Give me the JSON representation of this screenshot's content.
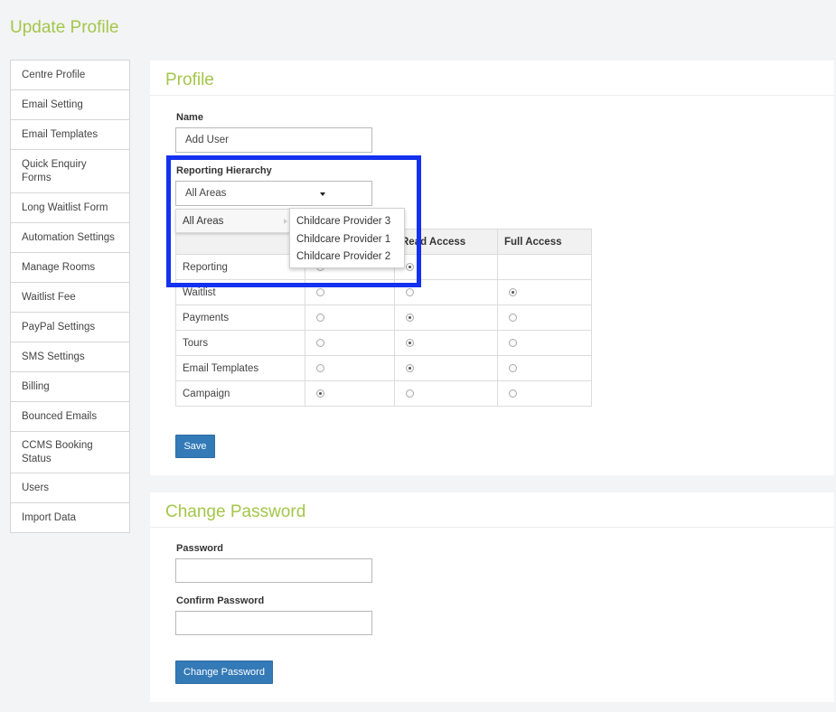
{
  "page": {
    "title": "Update Profile"
  },
  "sidebar": {
    "items": [
      {
        "label": "Centre Profile"
      },
      {
        "label": "Email Setting"
      },
      {
        "label": "Email Templates"
      },
      {
        "label": "Quick Enquiry Forms"
      },
      {
        "label": "Long Waitlist Form"
      },
      {
        "label": "Automation Settings"
      },
      {
        "label": "Manage Rooms"
      },
      {
        "label": "Waitlist Fee"
      },
      {
        "label": "PayPal Settings"
      },
      {
        "label": "SMS Settings"
      },
      {
        "label": "Billing"
      },
      {
        "label": "Bounced Emails"
      },
      {
        "label": "CCMS Booking Status"
      },
      {
        "label": "Users"
      },
      {
        "label": "Import Data"
      }
    ]
  },
  "profile": {
    "heading": "Profile",
    "name_label": "Name",
    "name_value": "Add User",
    "hierarchy_label": "Reporting Hierarchy",
    "hierarchy_value": "All Areas",
    "menu": {
      "item": "All Areas",
      "submenu": [
        "Childcare Provider 3",
        "Childcare Provider 1",
        "Childcare Provider 2"
      ]
    },
    "table": {
      "headers": [
        "",
        "",
        "Read Access",
        "Full Access"
      ],
      "rows": [
        {
          "label": "Reporting",
          "selected": 1,
          "options": 2
        },
        {
          "label": "Waitlist",
          "selected": 2,
          "options": 3
        },
        {
          "label": "Payments",
          "selected": 1,
          "options": 3
        },
        {
          "label": "Tours",
          "selected": 1,
          "options": 3
        },
        {
          "label": "Email Templates",
          "selected": 1,
          "options": 3
        },
        {
          "label": "Campaign",
          "selected": 0,
          "options": 3
        }
      ]
    },
    "save_label": "Save"
  },
  "password": {
    "heading": "Change Password",
    "password_label": "Password",
    "password_value": "",
    "confirm_label": "Confirm Password",
    "confirm_value": "",
    "button_label": "Change Password"
  },
  "colors": {
    "accent": "#a4c64a",
    "button": "#337ab7",
    "highlight": "#1331ee"
  }
}
